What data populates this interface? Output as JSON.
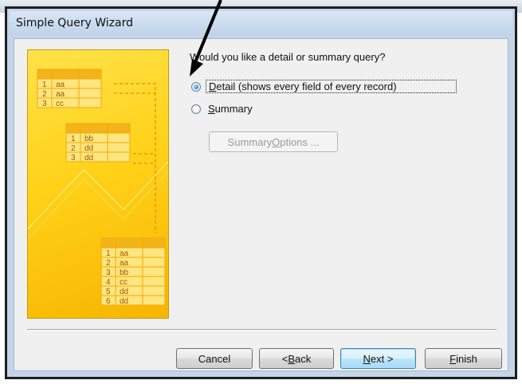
{
  "window": {
    "title": "Simple Query Wizard"
  },
  "illustration": {
    "table1": [
      {
        "n": "1",
        "v": "aa"
      },
      {
        "n": "2",
        "v": "aa"
      },
      {
        "n": "3",
        "v": "cc"
      }
    ],
    "table2": [
      {
        "n": "1",
        "v": "bb"
      },
      {
        "n": "2",
        "v": "dd"
      },
      {
        "n": "3",
        "v": "dd"
      }
    ],
    "table3": [
      {
        "n": "1",
        "v": "aa"
      },
      {
        "n": "2",
        "v": "aa"
      },
      {
        "n": "3",
        "v": "bb"
      },
      {
        "n": "4",
        "v": "cc"
      },
      {
        "n": "5",
        "v": "dd"
      },
      {
        "n": "6",
        "v": "dd"
      }
    ]
  },
  "question": "Would you like a detail or summary query?",
  "options": [
    {
      "label_pre": "",
      "label_accel": "D",
      "label_post": "etail (shows every field of every record)",
      "checked": true
    },
    {
      "label_pre": "",
      "label_accel": "S",
      "label_post": "ummary",
      "checked": false
    }
  ],
  "summary_options_button": {
    "pre": "Summary ",
    "accel": "O",
    "post": "ptions ...",
    "enabled": false
  },
  "buttons": {
    "cancel": {
      "pre": "Cancel",
      "accel": "",
      "post": ""
    },
    "back": {
      "pre": "< ",
      "accel": "B",
      "post": "ack"
    },
    "next": {
      "pre": "",
      "accel": "N",
      "post": "ext >"
    },
    "finish": {
      "pre": "",
      "accel": "F",
      "post": "inish"
    }
  },
  "colors": {
    "illustration_yellow": "#ffd21a",
    "table_orange": "#f6a800",
    "arrow": "#000000"
  }
}
